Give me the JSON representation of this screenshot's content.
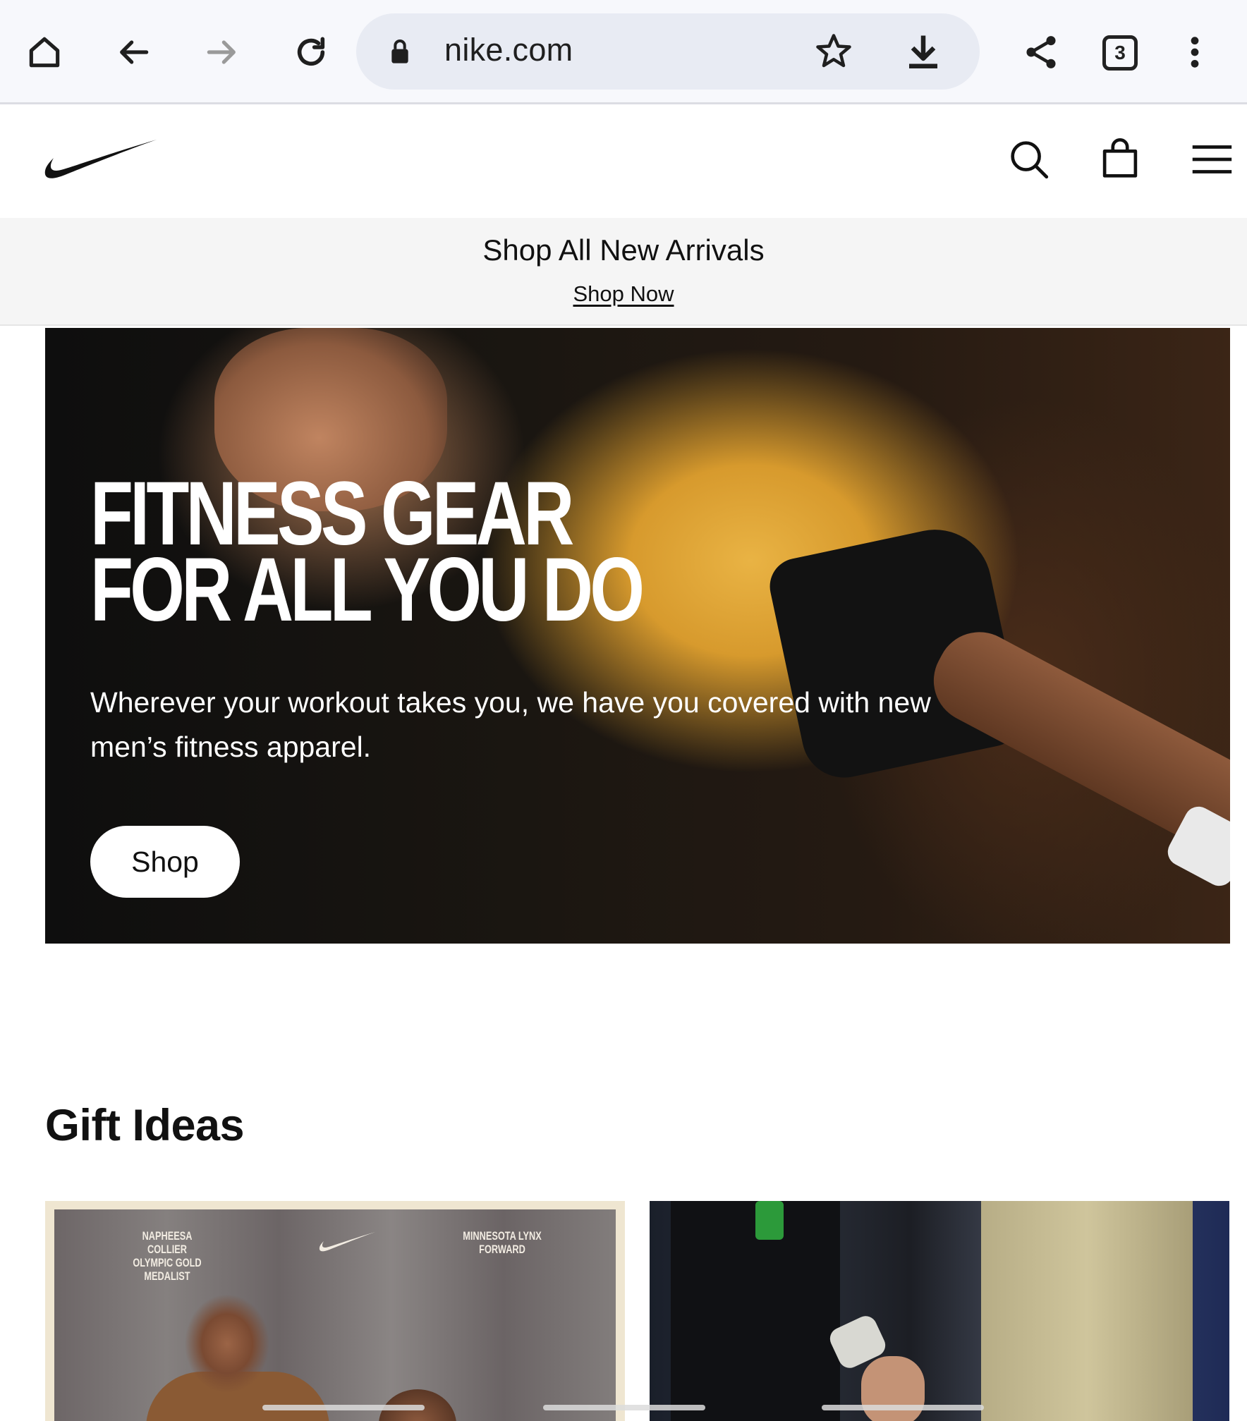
{
  "browser": {
    "url": "nike.com",
    "tab_count": "3",
    "icons": [
      "home-icon",
      "back-icon",
      "forward-icon",
      "reload-icon",
      "lock-icon",
      "star-icon",
      "download-icon",
      "share-icon",
      "tabs-icon",
      "more-vert-icon"
    ]
  },
  "header": {
    "icons": [
      "nike-swoosh-logo",
      "search-icon",
      "bag-icon",
      "menu-icon"
    ]
  },
  "promo": {
    "title": "Shop All New Arrivals",
    "link": "Shop Now"
  },
  "hero": {
    "title_line1": "FITNESS GEAR",
    "title_line2": "FOR ALL YOU DO",
    "subtitle": "Wherever your workout takes you, we have you covered with new men’s fitness apparel.",
    "button": "Shop"
  },
  "gift": {
    "title": "Gift Ideas",
    "card1": {
      "left_text_line1": "NAPHEESA COLLIER",
      "left_text_line2": "OLYMPIC GOLD MEDALIST",
      "right_text_line1": "MINNESOTA LYNX",
      "right_text_line2": "FORWARD"
    }
  },
  "colors": {
    "accent": "#111111",
    "browser_bg": "#f7f8fc",
    "url_pill": "#e8ebf3",
    "promo_bg": "#f5f5f5"
  }
}
